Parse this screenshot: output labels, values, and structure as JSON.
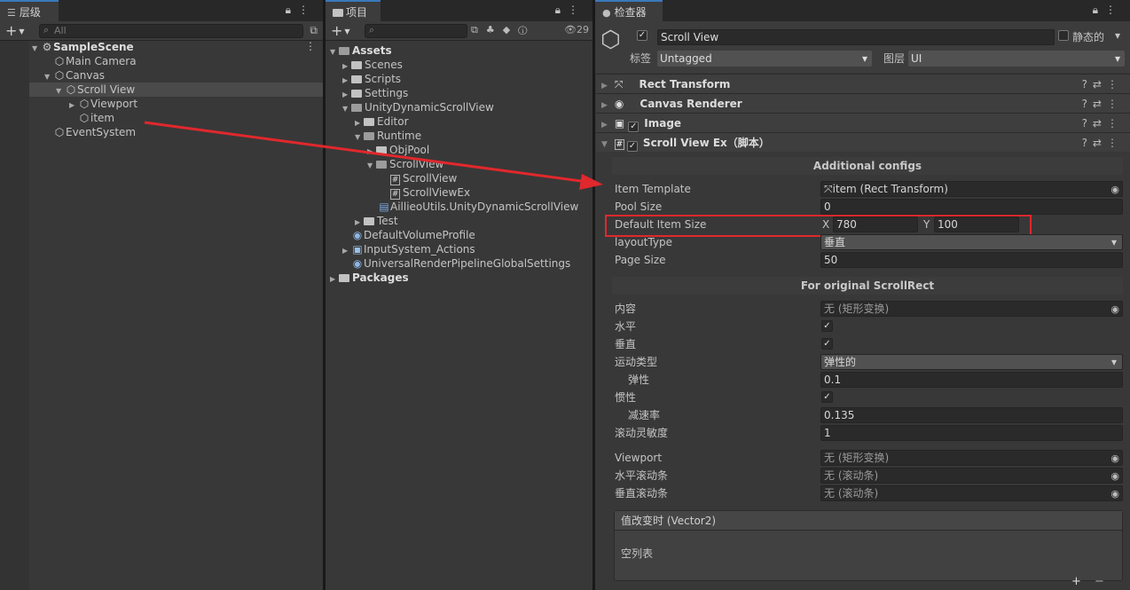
{
  "hierarchy": {
    "tab": "层级",
    "search_placeholder": "All",
    "scene": "SampleScene",
    "items": [
      "Main Camera",
      "Canvas",
      "Scroll View",
      "Viewport",
      "item",
      "EventSystem"
    ]
  },
  "project": {
    "tab": "项目",
    "count": "29",
    "items": [
      "Assets",
      "Scenes",
      "Scripts",
      "Settings",
      "UnityDynamicScrollView",
      "Editor",
      "Runtime",
      "ObjPool",
      "ScrollView",
      "ScrollView",
      "ScrollViewEx",
      "AillieoUtils.UnityDynamicScrollView",
      "Test",
      "DefaultVolumeProfile",
      "InputSystem_Actions",
      "UniversalRenderPipelineGlobalSettings",
      "Packages"
    ]
  },
  "inspector": {
    "tab": "检查器",
    "object_name": "Scroll View",
    "static_label": "静态的",
    "tag_label": "标签",
    "tag_value": "Untagged",
    "layer_label": "图层",
    "layer_value": "UI",
    "components": [
      "Rect Transform",
      "Canvas Renderer",
      "Image",
      "Scroll View Ex（脚本）"
    ],
    "section1": "Additional configs",
    "item_template_label": "Item Template",
    "item_template_value": "item (Rect Transform)",
    "pool_size_label": "Pool Size",
    "pool_size_value": "0",
    "default_item_size_label": "Default Item Size",
    "x_label": "X",
    "x_value": "780",
    "y_label": "Y",
    "y_value": "100",
    "layout_type_label": "layoutType",
    "layout_type_value": "垂直",
    "page_size_label": "Page Size",
    "page_size_value": "50",
    "section2": "For original ScrollRect",
    "content_label": "内容",
    "content_value": "无 (矩形变换)",
    "horizontal_label": "水平",
    "vertical_label": "垂直",
    "movement_label": "运动类型",
    "movement_value": "弹性的",
    "elasticity_label": "弹性",
    "elasticity_value": "0.1",
    "inertia_label": "惯性",
    "decel_label": "减速率",
    "decel_value": "0.135",
    "scroll_sens_label": "滚动灵敏度",
    "scroll_sens_value": "1",
    "viewport_label": "Viewport",
    "viewport_value": "无 (矩形变换)",
    "hscroll_label": "水平滚动条",
    "hscroll_value": "无 (滚动条)",
    "vscroll_label": "垂直滚动条",
    "vscroll_value": "无 (滚动条)",
    "event_label": "值改变时 (Vector2)",
    "event_empty": "空列表",
    "plus": "+",
    "minus": "−"
  },
  "colors": {
    "highlight_red": "#e0282d",
    "tab_accent": "#3a79bb"
  }
}
